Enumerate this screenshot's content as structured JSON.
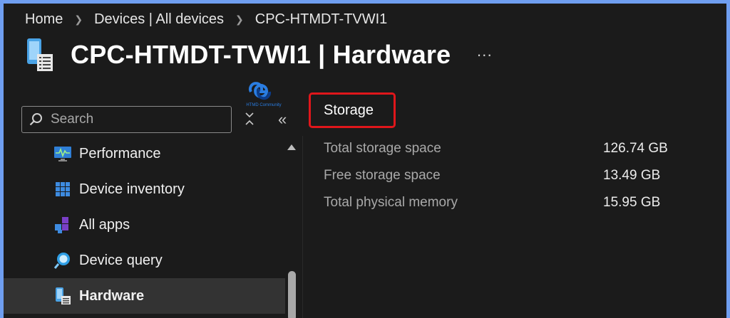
{
  "breadcrumb": {
    "home": "Home",
    "devices": "Devices | All devices",
    "current": "CPC-HTMDT-TVWI1"
  },
  "header": {
    "title": "CPC-HTMDT-TVWI1 | Hardware",
    "more": "···"
  },
  "logo": {
    "text": "HTMD Community"
  },
  "search": {
    "placeholder": "Search"
  },
  "controls": {
    "collapse": "«"
  },
  "nav": {
    "items": [
      {
        "label": "Performance",
        "icon": "performance-icon",
        "active": false
      },
      {
        "label": "Device inventory",
        "icon": "inventory-icon",
        "active": false
      },
      {
        "label": "All apps",
        "icon": "apps-icon",
        "active": false
      },
      {
        "label": "Device query",
        "icon": "query-icon",
        "active": false
      },
      {
        "label": "Hardware",
        "icon": "hardware-icon",
        "active": true
      }
    ]
  },
  "section": {
    "title": "Storage"
  },
  "properties": [
    {
      "label": "Total storage space",
      "value": "126.74 GB"
    },
    {
      "label": "Free storage space",
      "value": "13.49 GB"
    },
    {
      "label": "Total physical memory",
      "value": "15.95 GB"
    }
  ],
  "colors": {
    "accent_highlight": "#e0161b",
    "background": "#1b1b1b",
    "frame": "#6f9ef0"
  }
}
